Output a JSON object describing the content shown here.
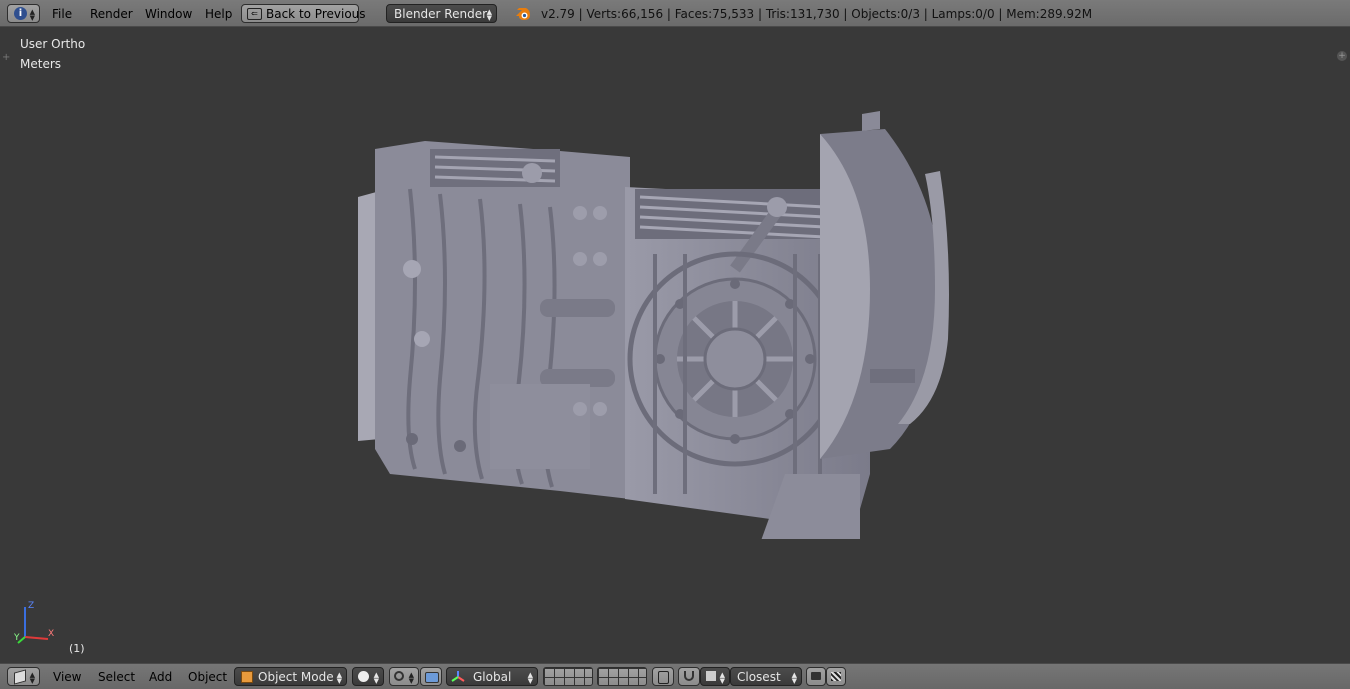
{
  "top": {
    "menus": [
      "File",
      "Render",
      "Window",
      "Help"
    ],
    "back_button": "Back to Previous",
    "render_engine": "Blender Render",
    "stats": "v2.79 | Verts:66,156 | Faces:75,533 | Tris:131,730 | Objects:0/3 | Lamps:0/0 | Mem:289.92M"
  },
  "viewport": {
    "view_name": "User Ortho",
    "units": "Meters",
    "frame": "(1)",
    "axis_labels": {
      "z": "Z",
      "y": "Y",
      "x": "X"
    }
  },
  "bottom": {
    "menus": [
      "View",
      "Select",
      "Add",
      "Object"
    ],
    "mode": "Object Mode",
    "orientation": "Global",
    "snap_target": "Closest"
  },
  "icons": {
    "info_editor": "info-icon",
    "blender_logo": "blender-logo-icon",
    "view3d_editor": "cube-icon",
    "mode_icon": "orange-cube-icon",
    "shading": "solid-sphere-icon",
    "pivot": "pivot-icon",
    "manipulator": "manipulator-icon",
    "snap": "magnet-icon",
    "render": "camera-icon",
    "animation": "clapboard-icon"
  },
  "colors": {
    "mesh": "#8a8a98",
    "background": "#393939",
    "blender_orange": "#e87d0d"
  }
}
